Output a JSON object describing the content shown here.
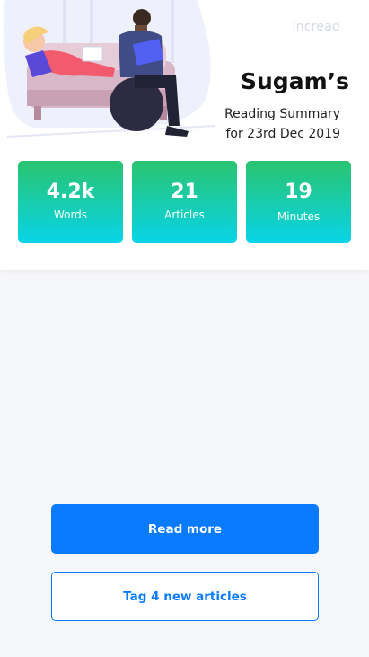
{
  "header": {
    "brand": "Incread",
    "name": "Sugam’s",
    "summary_line1": "Reading Summary",
    "summary_line2": "for 23rd Dec 2019"
  },
  "stats": [
    {
      "value": "4.2k",
      "label": "Words"
    },
    {
      "value": "21",
      "label": "Articles"
    },
    {
      "value": "19",
      "label": "Minutes"
    }
  ],
  "actions": {
    "read_more": "Read more",
    "tag_articles": "Tag 4 new articles"
  },
  "colors": {
    "accent": "#0a7bff",
    "stat_gradient_top": "#29c46f",
    "stat_gradient_bottom": "#09d4e8",
    "background": "#f6f7fb"
  }
}
